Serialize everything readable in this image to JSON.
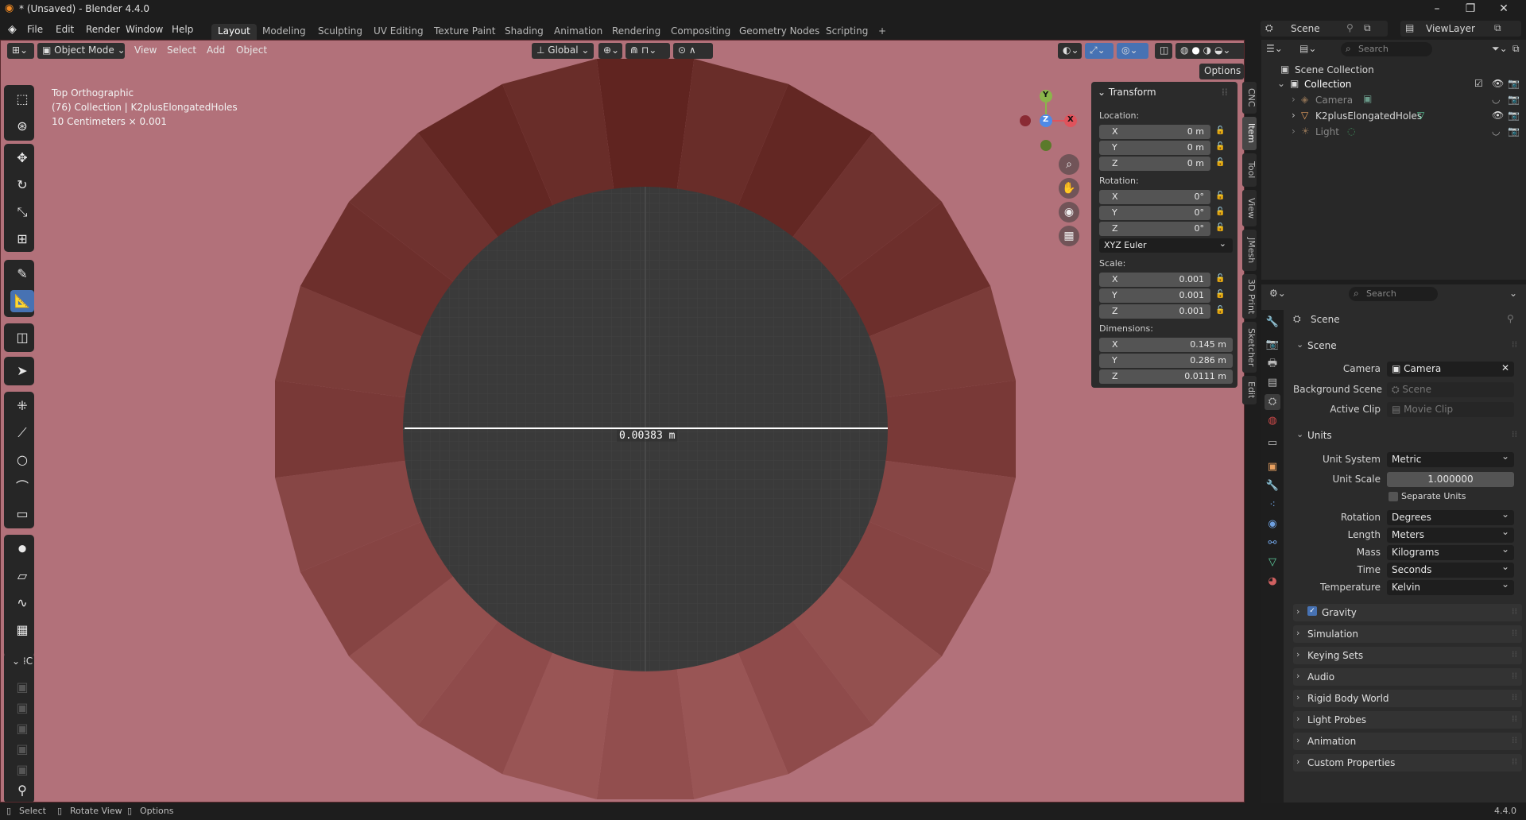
{
  "window": {
    "title": "* (Unsaved) - Blender 4.4.0",
    "controls": [
      "minimize",
      "restore",
      "close"
    ]
  },
  "menubar": {
    "items": [
      "File",
      "Edit",
      "Render",
      "Window",
      "Help"
    ]
  },
  "workspaces": {
    "tabs": [
      "Layout",
      "Modeling",
      "Sculpting",
      "UV Editing",
      "Texture Paint",
      "Shading",
      "Animation",
      "Rendering",
      "Compositing",
      "Geometry Nodes",
      "Scripting"
    ],
    "active": "Layout",
    "add_label": "+"
  },
  "scene_selector": {
    "scene": "Scene",
    "view_layer": "ViewLayer"
  },
  "viewport": {
    "header": {
      "mode": "Object Mode",
      "menus": [
        "View",
        "Select",
        "Add",
        "Object"
      ],
      "orientation": "Global",
      "options_label": "Options"
    },
    "overlay": {
      "view_name": "Top Orthographic",
      "collection_line": "(76) Collection | K2plusElongatedHoles",
      "scale_line": "10 Centimeters × 0.001"
    },
    "measurement": "0.00383 m",
    "gizmo": {
      "y": "Y",
      "z": "Z",
      "x": "X"
    },
    "colors": {
      "background": "#b2717a",
      "ring": "#7a3530",
      "hole": "#3b3b3b"
    },
    "toolbar_collapsed_label": "C"
  },
  "transform_panel": {
    "title": "Transform",
    "location_label": "Location:",
    "location": [
      {
        "axis": "X",
        "value": "0 m"
      },
      {
        "axis": "Y",
        "value": "0 m"
      },
      {
        "axis": "Z",
        "value": "0 m"
      }
    ],
    "rotation_label": "Rotation:",
    "rotation": [
      {
        "axis": "X",
        "value": "0°"
      },
      {
        "axis": "Y",
        "value": "0°"
      },
      {
        "axis": "Z",
        "value": "0°"
      }
    ],
    "rotation_mode": "XYZ Euler",
    "scale_label": "Scale:",
    "scale": [
      {
        "axis": "X",
        "value": "0.001"
      },
      {
        "axis": "Y",
        "value": "0.001"
      },
      {
        "axis": "Z",
        "value": "0.001"
      }
    ],
    "dimensions_label": "Dimensions:",
    "dimensions": [
      {
        "axis": "X",
        "value": "0.145 m"
      },
      {
        "axis": "Y",
        "value": "0.286 m"
      },
      {
        "axis": "Z",
        "value": "0.0111 m"
      }
    ]
  },
  "sidebar_tabs": [
    "CNC",
    "Item",
    "Tool",
    "View",
    "JMesh",
    "3D Print",
    "Sketcher",
    "Edit"
  ],
  "sidebar_active": "Item",
  "outliner": {
    "search_placeholder": "Search",
    "root": "Scene Collection",
    "collection": "Collection",
    "objects": [
      "Camera",
      "K2plusElongatedHoles",
      "Light"
    ]
  },
  "properties": {
    "search_placeholder": "Search",
    "context_title": "Scene",
    "scene_section": "Scene",
    "camera_label": "Camera",
    "camera_value": "Camera",
    "background_scene_label": "Background Scene",
    "background_scene_placeholder": "Scene",
    "active_clip_label": "Active Clip",
    "active_clip_placeholder": "Movie Clip",
    "units_section": "Units",
    "unit_system_label": "Unit System",
    "unit_system": "Metric",
    "unit_scale_label": "Unit Scale",
    "unit_scale": "1.000000",
    "separate_units_label": "Separate Units",
    "rotation_label": "Rotation",
    "rotation": "Degrees",
    "length_label": "Length",
    "length": "Meters",
    "mass_label": "Mass",
    "mass": "Kilograms",
    "time_label": "Time",
    "time": "Seconds",
    "temperature_label": "Temperature",
    "temperature": "Kelvin",
    "collapsed_sections": [
      "Gravity",
      "Simulation",
      "Keying Sets",
      "Audio",
      "Rigid Body World",
      "Light Probes",
      "Animation",
      "Custom Properties"
    ]
  },
  "statusbar": {
    "select": "Select",
    "rotate": "Rotate View",
    "options": "Options",
    "version": "4.4.0"
  }
}
